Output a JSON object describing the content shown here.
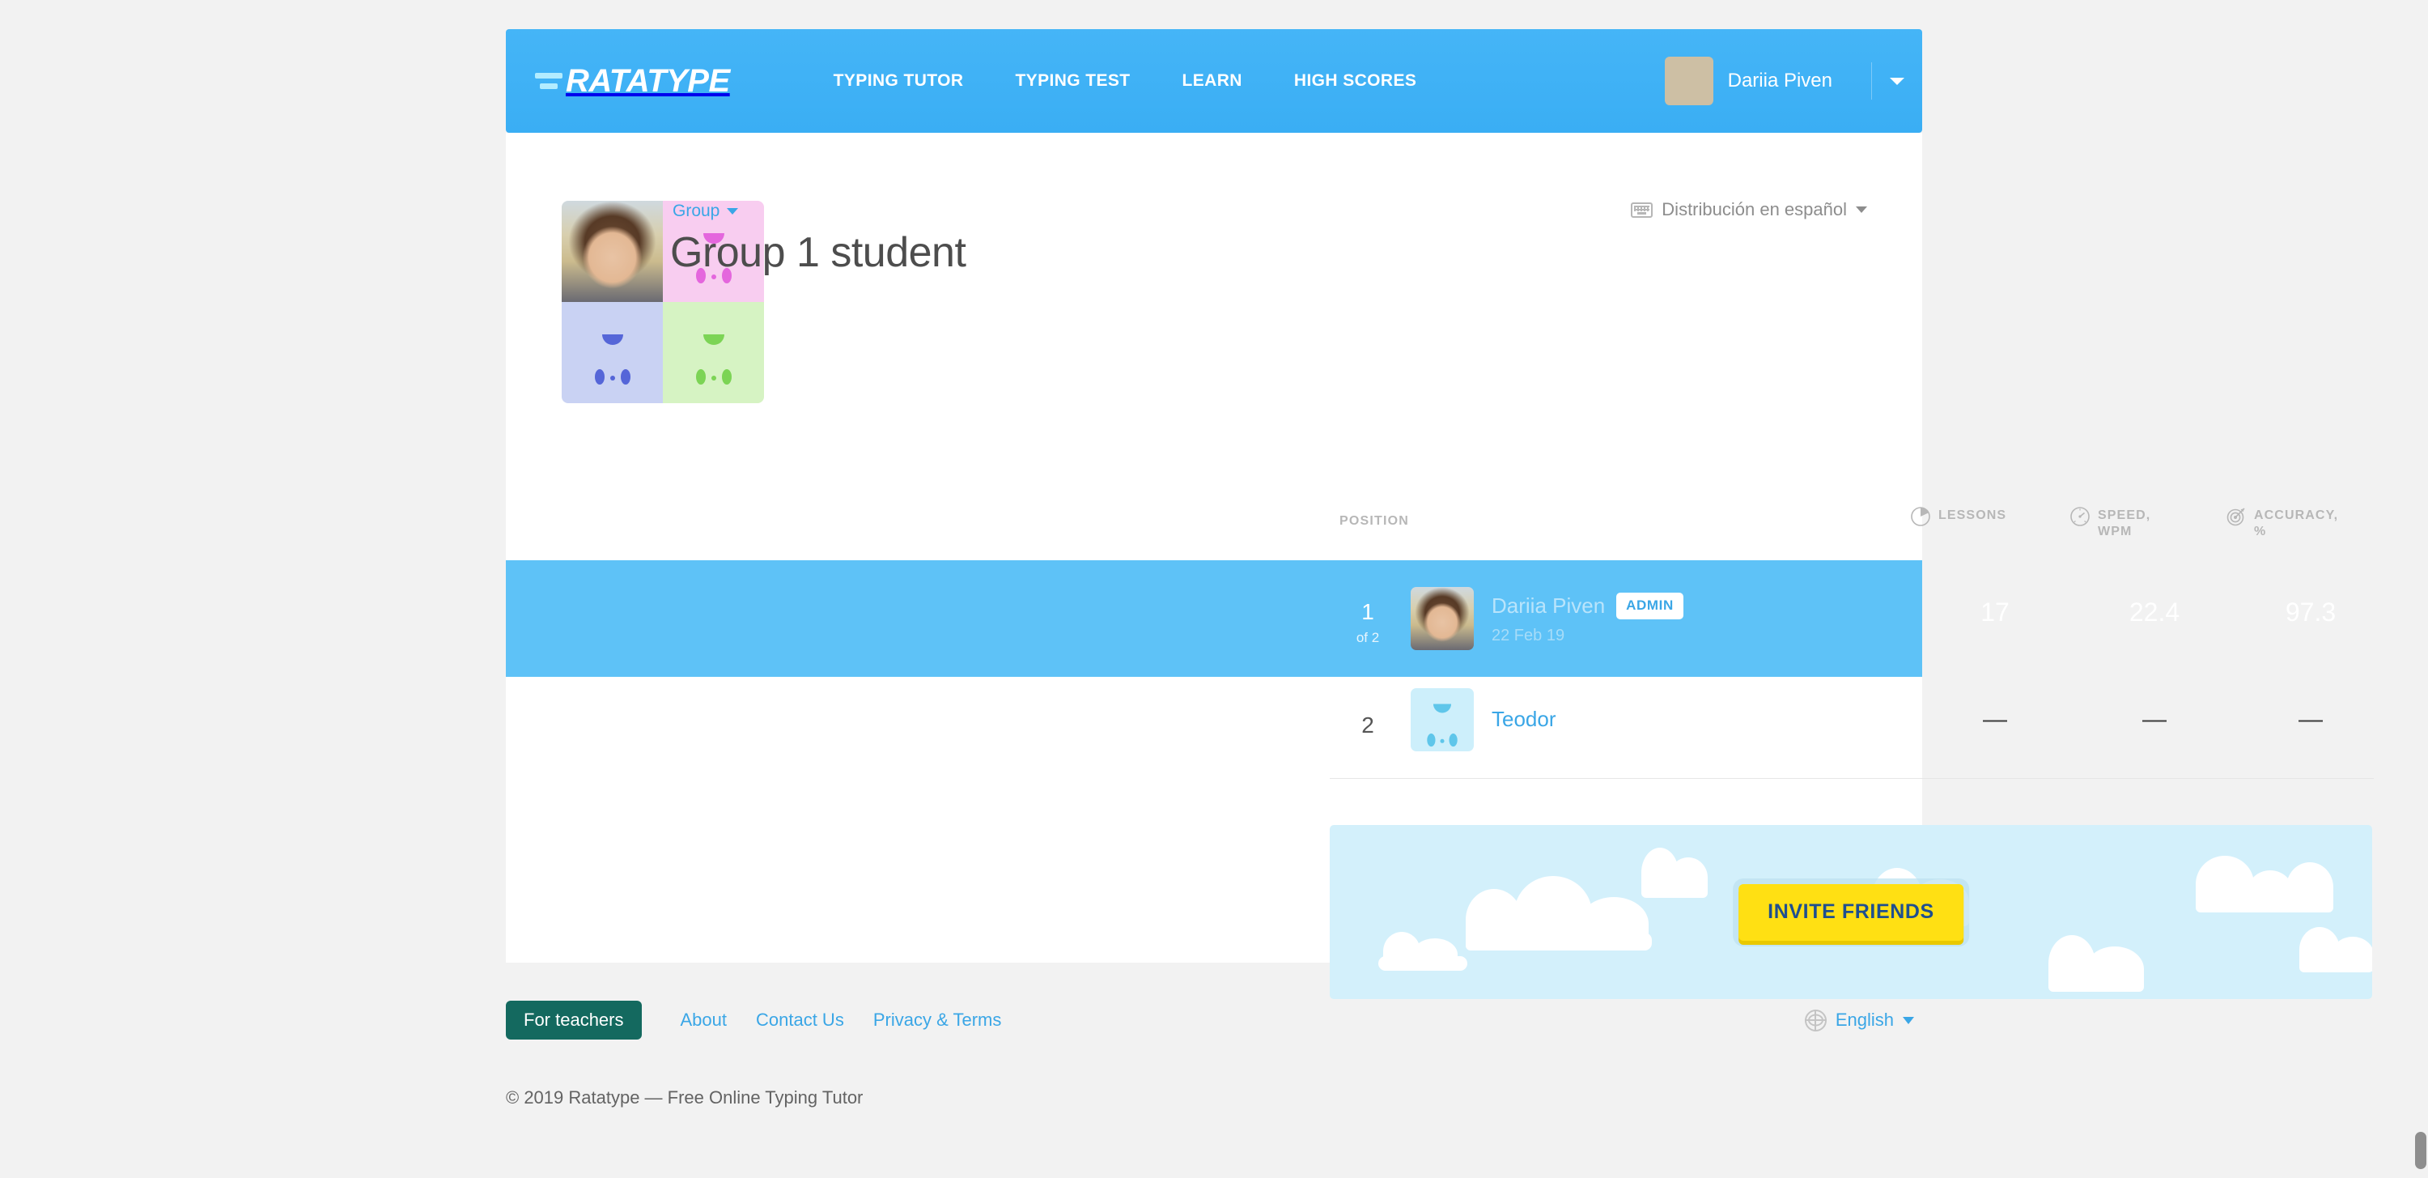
{
  "header": {
    "logo_text": "RATATYPE",
    "logo_icon": "speed-lines-icon",
    "nav": [
      {
        "label": "TYPING TUTOR"
      },
      {
        "label": "TYPING TEST"
      },
      {
        "label": "LEARN"
      },
      {
        "label": "HIGH SCORES"
      }
    ],
    "user": {
      "name": "Dariia Piven",
      "avatar": "user-photo-avatar",
      "caret": "chevron-down-icon"
    },
    "background_color": "#3fb3f6"
  },
  "group": {
    "collage_alt": "group-avatars-collage",
    "breadcrumb": {
      "label": "Group",
      "caret": "caret-down-icon"
    },
    "title": "Group 1 student",
    "keyboard_layout": {
      "icon": "keyboard-icon",
      "label": "Distribución en español",
      "caret": "caret-down-icon"
    }
  },
  "table": {
    "columns": {
      "position": "POSITION",
      "lessons": {
        "label": "LESSONS",
        "icon": "pie-chart-icon"
      },
      "speed": {
        "label": "SPEED,\nWPM",
        "icon": "speedometer-icon"
      },
      "accuracy": {
        "label": "ACCURACY,\n%",
        "icon": "target-icon"
      }
    },
    "rows": [
      {
        "position": "1",
        "position_of": "of 2",
        "name": "Dariia Piven",
        "badge": "ADMIN",
        "date": "22 Feb 19",
        "lessons": "17",
        "speed": "22.4",
        "accuracy": "97.3",
        "highlighted": true,
        "avatar": "photo"
      },
      {
        "position": "2",
        "position_of": "",
        "name": "Teodor",
        "badge": "",
        "date": "",
        "lessons": "—",
        "speed": "—",
        "accuracy": "—",
        "highlighted": false,
        "avatar": "face-blue"
      }
    ]
  },
  "invite": {
    "button_label": "INVITE FRIENDS",
    "background_color": "#d3f0fb",
    "button_color": "#ffe013"
  },
  "footer": {
    "for_teachers": "For teachers",
    "links": [
      {
        "label": "About"
      },
      {
        "label": "Contact Us"
      },
      {
        "label": "Privacy & Terms"
      }
    ],
    "language": {
      "icon": "globe-icon",
      "label": "English",
      "caret": "caret-down-icon"
    },
    "copyright": "© 2019 Ratatype — Free Online Typing Tutor"
  }
}
